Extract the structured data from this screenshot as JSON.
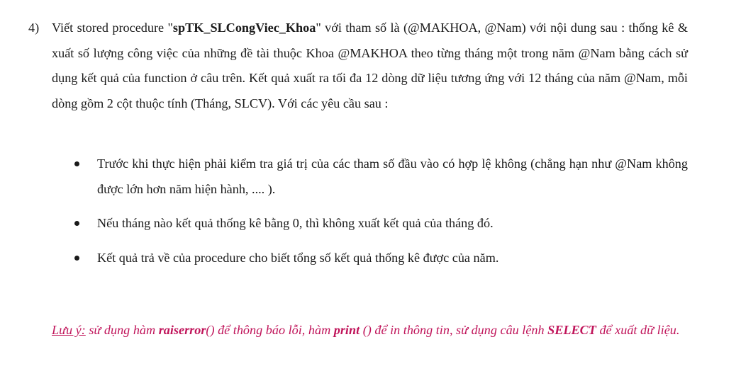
{
  "item": {
    "number": "4)",
    "text_before": "Viết stored procedure \"",
    "procedure_name": "spTK_SLCongViec_Khoa",
    "text_after": "\" với tham số là (@MAKHOA, @Nam) với nội dung sau : thống kê & xuất số lượng công việc của những đề tài thuộc Khoa @MAKHOA theo từng tháng một trong năm @Nam bằng cách sử dụng kết quả của function ở câu trên. Kết quả xuất ra tối đa 12 dòng dữ liệu tương ứng với 12 tháng của năm @Nam, mỗi dòng gồm 2 cột thuộc tính (Tháng, SLCV). Với các yêu cầu sau :"
  },
  "bullets": [
    "Trước khi thực hiện phải kiểm tra giá trị của các tham số đầu vào có hợp lệ không (chẳng hạn như @Nam không được lớn hơn năm hiện hành, .... ).",
    "Nếu tháng nào kết quả thống kê bằng 0, thì không xuất kết quả của tháng đó.",
    "Kết quả trả về của procedure cho biết tổng số kết quả thống kê được của năm."
  ],
  "note": {
    "label": "Lưu ý:",
    "part1": " sử dụng hàm ",
    "kw1": "raiserror",
    "part2": "() để thông báo lỗi, hàm ",
    "kw2": "print",
    "part3": " () để in thông tin, sử dụng câu lệnh ",
    "kw3": "SELECT",
    "part4": " để xuất dữ liệu."
  },
  "colors": {
    "text": "#1a1a1a",
    "note": "#c0145a"
  }
}
